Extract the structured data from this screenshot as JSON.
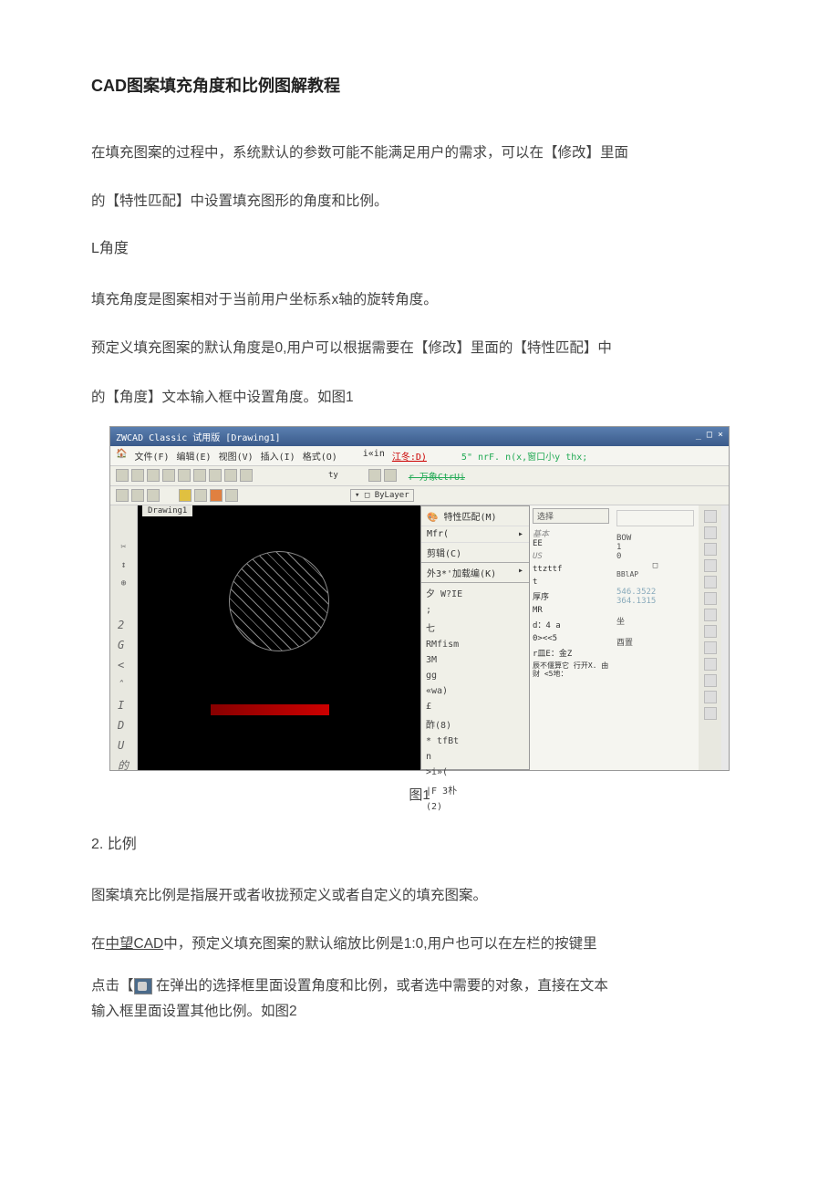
{
  "title": "CAD图案填充角度和比例图解教程",
  "intro_p1": "在填充图案的过程中，系统默认的参数可能不能满足用户的需求，可以在【修改】里面",
  "intro_p2": "的【特性匹配】中设置填充图形的角度和比例。",
  "section1_heading": "L角度",
  "section1_p1": "填充角度是图案相对于当前用户坐标系x轴的旋转角度。",
  "section1_p2": "预定义填充图案的默认角度是0,用户可以根据需要在【修改】里面的【特性匹配】中",
  "section1_p3": "的【角度】文本输入框中设置角度。如图1",
  "figure1_caption": "图1",
  "section2_heading": "2. 比例",
  "section2_p1": "图案填充比例是指展开或者收拢预定义或者自定义的填充图案。",
  "section2_p2a": "在",
  "section2_p2_link": "中望CAD",
  "section2_p2b": "中，预定义填充图案的默认缩放比例是1:0,用户也可以在左栏的按键里",
  "section2_p3a": "点击【",
  "section2_p3b": "  在弹出的选择框里面设置角度和比例，或者选中需要的对象，直接在文本",
  "section2_p4": "输入框里面设置其他比例。如图2",
  "app": {
    "titlebar": "ZWCAD Classic 试用版  [Drawing1]",
    "menu": {
      "file": "文件(F)",
      "edit": "编辑(E)",
      "view": "视图(V)",
      "insert": "插入(I)",
      "format": "格式(O)"
    },
    "toolbar_left": "i«in",
    "toolbar_red": "江冬:D)",
    "toolbar_mid": "ty",
    "toolbar_layer": "ByLayer",
    "drawing_tab": "Drawing1",
    "left_letters": [
      "2",
      "G",
      "<",
      "ˆ",
      "I",
      "D",
      "U",
      "的"
    ],
    "top_text1": "5\" nrF. n(x,窗口小y thx;",
    "top_text2": "r 万象CtrUi",
    "dropdown": {
      "item1": "特性匹配(M)",
      "item2": "Mfr(",
      "item3": "剪辑(C)",
      "item4": "外3*'加载编(K)",
      "item_arrow": "▸"
    },
    "select_label": "选择",
    "submenu": {
      "i1": "夕 W?IE",
      "i2": ";",
      "i3": "七",
      "i4": "RMfism",
      "i5": "3M",
      "i6": "gg",
      "i7": "«wa)",
      "i8": "£",
      "i9": "酢(8)",
      "i10": "* tfBt",
      "i11": "n",
      "i12": ">i»(",
      "i13": "|F 3朴",
      "i14": "(2)"
    },
    "props": {
      "g1": "基本",
      "g1a": "EE",
      "g2": "US",
      "g3": "ttzttf",
      "g4": "t",
      "g5": "厚序",
      "g6": "MR",
      "g7": "d：4 a",
      "g8": "0><<5",
      "g9": "r皿E：金Z",
      "g10": "辰不偃算它 行开X. 由财 <5地："
    },
    "right": {
      "r1": "BOW",
      "r2": "1",
      "r3": "0",
      "r4": "□",
      "r5": "BBlAP",
      "r6": "546.3522",
      "r7": "364.1315",
      "r8": "坐",
      "r9": "酉置"
    }
  }
}
